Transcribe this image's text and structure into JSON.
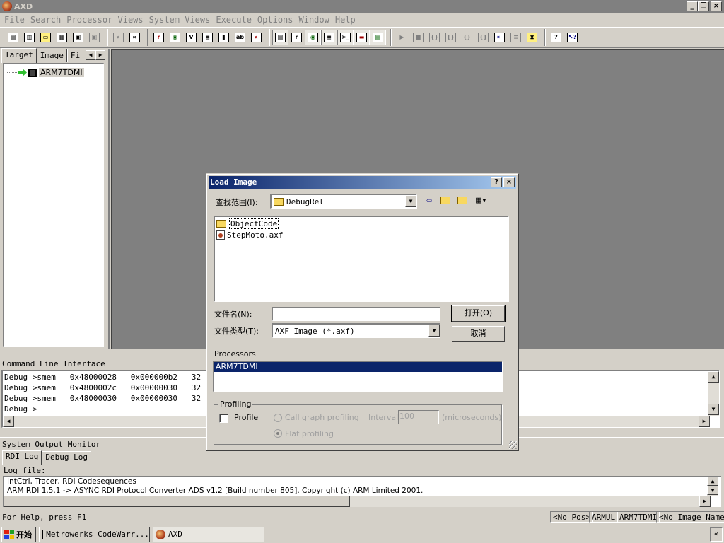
{
  "app": {
    "title": "AXD"
  },
  "menu": [
    {
      "label": "File"
    },
    {
      "label": "Search"
    },
    {
      "label": "Processor Views"
    },
    {
      "label": "System Views"
    },
    {
      "label": "Execute"
    },
    {
      "label": "Options"
    },
    {
      "label": "Window"
    },
    {
      "label": "Help"
    }
  ],
  "left_panel": {
    "tabs": [
      "Target",
      "Image",
      "Fi"
    ],
    "tree_item": "ARM7TDMI"
  },
  "cli": {
    "title": "Command Line Interface",
    "lines": [
      "Debug >smem   0x48000028   0x000000b2   32",
      "Debug >smem   0x4800002c   0x00000030   32",
      "Debug >smem   0x48000030   0x00000030   32",
      "Debug >"
    ]
  },
  "som": {
    "title": "System Output Monitor",
    "tabs": [
      "RDI Log",
      "Debug Log"
    ],
    "log_file_label": "Log file:",
    "lines": [
      "IntCtrl, Tracer, RDI Codesequences",
      "ARM RDI 1.5.1 -> ASYNC RDI Protocol Converter ADS v1.2 [Build number 805]. Copyright (c) ARM Limited 2001."
    ]
  },
  "status": {
    "help": "For Help, press F1",
    "pos": "<No Pos>",
    "target": "ARMUL",
    "processor": "ARM7TDMI",
    "image": "<No Image Name>"
  },
  "taskbar": {
    "start": "开始",
    "items": [
      "Metrowerks CodeWarr...",
      "AXD"
    ]
  },
  "dialog": {
    "title": "Load Image",
    "look_in_label": "查找范围(I):",
    "look_in_value": "DebugRel",
    "files": [
      "ObjectCode",
      "StepMoto.axf"
    ],
    "filename_label": "文件名(N):",
    "filename_value": "",
    "filetype_label": "文件类型(T):",
    "filetype_value": "AXF Image (*.axf)",
    "open_button": "打开(O)",
    "cancel_button": "取消",
    "processors_label": "Processors",
    "processors": [
      "ARM7TDMI"
    ],
    "profiling_label": "Profiling",
    "profile_check": "Profile",
    "call_graph": "Call graph profiling",
    "flat": "Flat profiling",
    "interval_label": "Interval:",
    "interval_value": "100",
    "interval_unit": "(microseconds)"
  },
  "colors": {
    "desktop_gray": "#808080",
    "face": "#d4d0c8",
    "selection": "#0a246a"
  }
}
